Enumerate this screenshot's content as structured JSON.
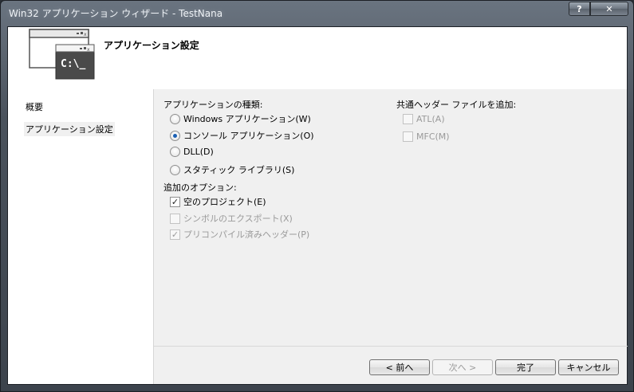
{
  "window": {
    "title": "Win32 アプリケーション ウィザード - TestNana",
    "help_label": "?",
    "close_label": "✕"
  },
  "header": {
    "title": "アプリケーション設定",
    "icon": "console-window-icon",
    "icon_text": "C:\\_"
  },
  "sidebar": {
    "items": [
      {
        "label": "概要",
        "selected": false
      },
      {
        "label": "アプリケーション設定",
        "selected": true
      }
    ]
  },
  "app_type": {
    "label": "アプリケーションの種類:",
    "options": [
      {
        "label": "Windows アプリケーション(W)",
        "selected": false
      },
      {
        "label": "コンソール アプリケーション(O)",
        "selected": true
      },
      {
        "label": "DLL(D)",
        "selected": false
      },
      {
        "label": "スタティック ライブラリ(S)",
        "selected": false
      }
    ]
  },
  "extra_options": {
    "label": "追加のオプション:",
    "options": [
      {
        "label": "空のプロジェクト(E)",
        "checked": true,
        "enabled": true
      },
      {
        "label": "シンボルのエクスポート(X)",
        "checked": false,
        "enabled": false
      },
      {
        "label": "プリコンパイル済みヘッダー(P)",
        "checked": true,
        "enabled": false
      }
    ]
  },
  "common_headers": {
    "label": "共通ヘッダー ファイルを追加:",
    "options": [
      {
        "label": "ATL(A)",
        "checked": false,
        "enabled": false
      },
      {
        "label": "MFC(M)",
        "checked": false,
        "enabled": false
      }
    ]
  },
  "buttons": {
    "prev": "< 前へ",
    "next": "次へ >",
    "finish": "完了",
    "cancel": "キャンセル"
  },
  "check_mark": "✓"
}
